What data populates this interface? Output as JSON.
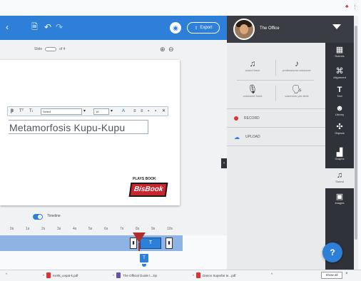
{
  "toolbar": {
    "export_label": "Export"
  },
  "user": {
    "name": "The Office"
  },
  "canvas": {
    "size_label": "Slide",
    "size_of": "of 4",
    "title_text": "Metamorfosis Kupu-Kupu",
    "font_name": "Select",
    "font_size": "16",
    "logo_small": "PLAYS BOOK",
    "logo_big": "BisBook"
  },
  "timeline": {
    "label": "Timeline",
    "ticks": [
      "0s",
      "1s",
      "2s",
      "3s",
      "4s",
      "5s",
      "6s",
      "7s",
      "8s",
      "9s",
      "10s"
    ],
    "selected_label": "T",
    "marker_label": "T"
  },
  "sound_panel": {
    "items": [
      {
        "icon": "music-note-icon",
        "label": "sound track"
      },
      {
        "icon": "music-notes-icon",
        "label": "professional voiceover"
      },
      {
        "icon": "microphone-icon",
        "label": "voiceover track"
      },
      {
        "icon": "voiceover-tts-icon",
        "label": "voiceover per slide"
      }
    ],
    "record_label": "RECORD",
    "upload_label": "UPLOAD"
  },
  "right_tools": [
    {
      "icon": "scenes-icon",
      "label": "Scenes"
    },
    {
      "icon": "alignment-icon",
      "label": "Alignment"
    },
    {
      "icon": "text-icon",
      "label": "Text"
    },
    {
      "icon": "library-icon",
      "label": "Library"
    },
    {
      "icon": "objects-icon",
      "label": "Objects"
    },
    {
      "icon": "graphs-icon",
      "label": "Graphs"
    },
    {
      "icon": "sound-icon",
      "label": "Sound"
    },
    {
      "icon": "images-icon",
      "label": "Images"
    }
  ],
  "help_label": "?",
  "downloads": {
    "items": [
      {
        "name": "Kertk_cepat-k.pdf"
      },
      {
        "name": "The Official Guide t...zip"
      },
      {
        "name": "Dance Superbe te...pdf"
      }
    ],
    "show_all": "Show all",
    "close": "×"
  },
  "colors": {
    "accent": "#2e7fd8",
    "panel_dark": "#2f3238",
    "playhead": "#b22a2a"
  }
}
